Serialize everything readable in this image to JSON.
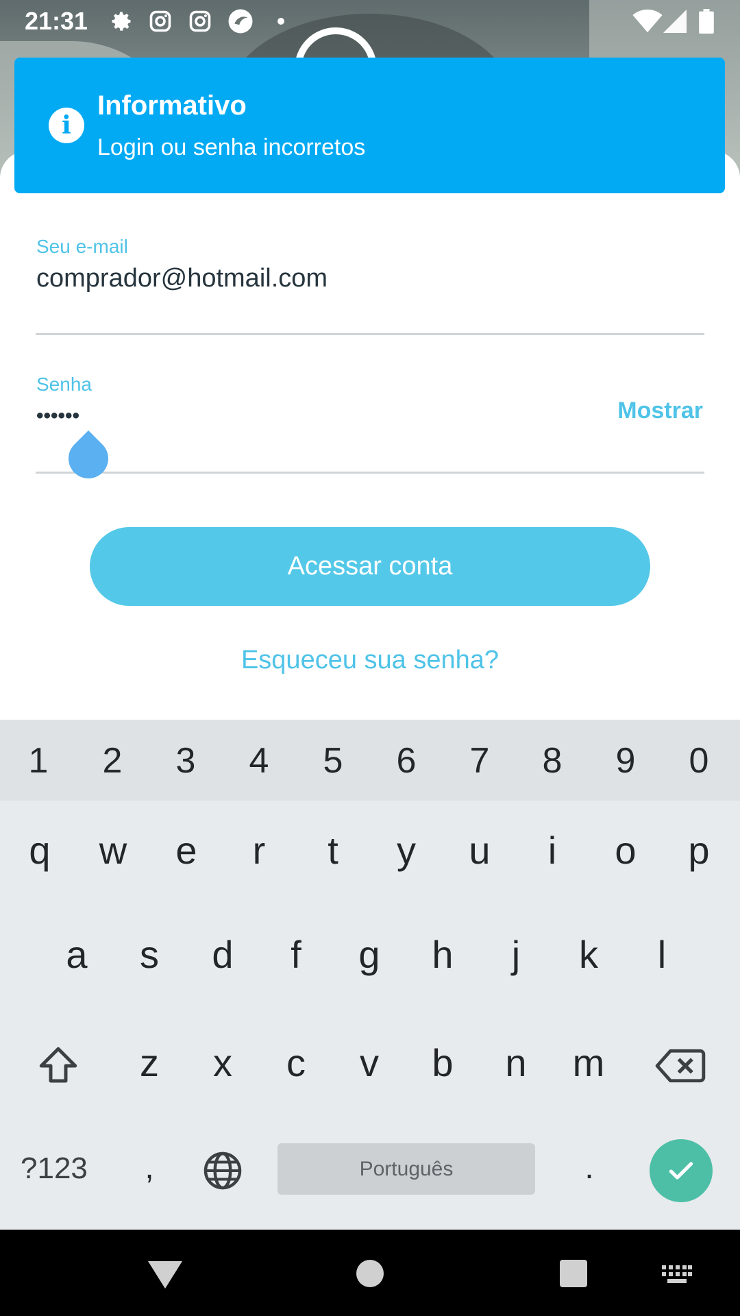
{
  "status_bar": {
    "time": "21:31",
    "icons": [
      "gear-icon",
      "instagram-icon",
      "instagram-icon",
      "app-icon",
      "wifi-icon",
      "signal-icon",
      "battery-icon"
    ]
  },
  "toast": {
    "title": "Informativo",
    "message": "Login ou senha incorretos",
    "icon": "info-icon",
    "color": "#02aaf4"
  },
  "form": {
    "email_label": "Seu e-mail",
    "email_value": "comprador@hotmail.com",
    "password_label": "Senha",
    "password_value": "••••••",
    "show_label": "Mostrar",
    "submit_label": "Acessar conta",
    "forgot_label": "Esqueceu sua senha?"
  },
  "keyboard": {
    "number_row": [
      "1",
      "2",
      "3",
      "4",
      "5",
      "6",
      "7",
      "8",
      "9",
      "0"
    ],
    "row1": [
      "q",
      "w",
      "e",
      "r",
      "t",
      "y",
      "u",
      "i",
      "o",
      "p"
    ],
    "row2": [
      "a",
      "s",
      "d",
      "f",
      "g",
      "h",
      "j",
      "k",
      "l"
    ],
    "row3": [
      "z",
      "x",
      "c",
      "v",
      "b",
      "n",
      "m"
    ],
    "symbols_label": "?123",
    "comma": ",",
    "space_label": "Português",
    "period": ".",
    "accent_color": "#4cbfa6"
  },
  "colors": {
    "primary": "#54c8e8",
    "link": "#4fc3e8",
    "text": "#26343d"
  }
}
